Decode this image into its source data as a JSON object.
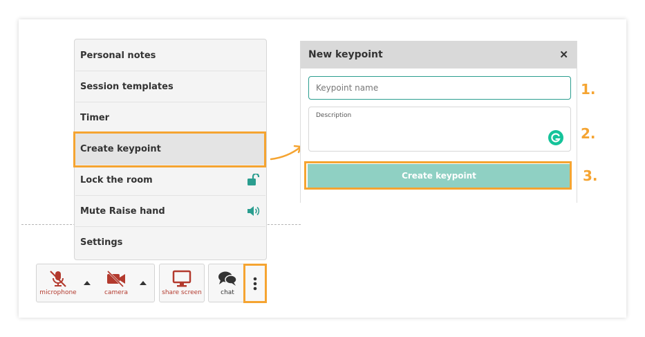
{
  "menu": {
    "items": [
      {
        "label": "Personal notes"
      },
      {
        "label": "Session templates"
      },
      {
        "label": "Timer"
      },
      {
        "label": "Create keypoint"
      },
      {
        "label": "Lock the room",
        "icon": "unlock-icon"
      },
      {
        "label": "Mute Raise hand",
        "icon": "speaker-icon"
      },
      {
        "label": "Settings"
      }
    ]
  },
  "toolbar": {
    "microphone_label": "microphone",
    "camera_label": "camera",
    "share_screen_label": "share screen",
    "chat_label": "chat"
  },
  "dialog": {
    "title": "New keypoint",
    "close_symbol": "✕",
    "name_placeholder": "Keypoint name",
    "description_label": "Description",
    "create_button_label": "Create keypoint"
  },
  "steps": [
    "1.",
    "2.",
    "3."
  ],
  "colors": {
    "highlight": "#f5a431",
    "accent": "#2a9d8f",
    "button": "#8fd0c3",
    "device_off": "#b33a2e"
  }
}
